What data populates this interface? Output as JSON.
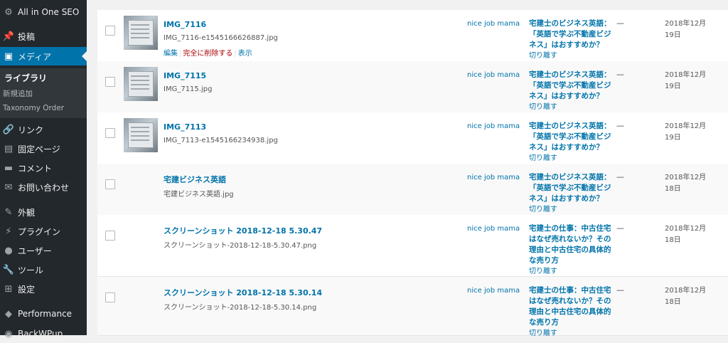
{
  "sidebar": {
    "items": [
      {
        "label": "All in One SEO",
        "icon": "seo-icon"
      },
      {
        "label": "投稿",
        "icon": "pin-icon"
      },
      {
        "label": "メディア",
        "icon": "media-icon",
        "active": true
      },
      {
        "label": "リンク",
        "icon": "link-icon"
      },
      {
        "label": "固定ページ",
        "icon": "page-icon"
      },
      {
        "label": "コメント",
        "icon": "comment-icon"
      },
      {
        "label": "お問い合わせ",
        "icon": "mail-icon"
      },
      {
        "label": "外観",
        "icon": "brush-icon"
      },
      {
        "label": "プラグイン",
        "icon": "plugin-icon"
      },
      {
        "label": "ユーザー",
        "icon": "user-icon"
      },
      {
        "label": "ツール",
        "icon": "wrench-icon"
      },
      {
        "label": "設定",
        "icon": "settings-icon"
      },
      {
        "label": "Performance",
        "icon": "performance-icon"
      },
      {
        "label": "BackWPup",
        "icon": "backup-icon"
      }
    ],
    "submenu": [
      "ライブラリ",
      "新規追加",
      "Taxonomy Order"
    ]
  },
  "actions": {
    "edit": "編集",
    "delete": "完全に削除する",
    "view": "表示"
  },
  "rows": [
    {
      "title": "IMG_7116",
      "file": "IMG_7116-e1545166626887.jpg",
      "author": "nice job mama",
      "attached": "宅建士のビジネス英語：「英語で学ぶ不動産ビジネス」はおすすめか？",
      "detach": "切り離す",
      "comments": "—",
      "date": "2018年12月19日"
    },
    {
      "title": "IMG_7115",
      "file": "IMG_7115.jpg",
      "author": "nice job mama",
      "attached": "宅建士のビジネス英語：「英語で学ぶ不動産ビジネス」はおすすめか？",
      "detach": "切り離す",
      "comments": "—",
      "date": "2018年12月19日"
    },
    {
      "title": "IMG_7113",
      "file": "IMG_7113-e1545166234938.jpg",
      "author": "nice job mama",
      "attached": "宅建士のビジネス英語：「英語で学ぶ不動産ビジネス」はおすすめか？",
      "detach": "切り離す",
      "comments": "—",
      "date": "2018年12月19日"
    },
    {
      "title": "宅建ビジネス英語",
      "file": "宅建ビジネス英語.jpg",
      "author": "nice job mama",
      "attached": "宅建士のビジネス英語：「英語で学ぶ不動産ビジネス」はおすすめか？",
      "detach": "切り離す",
      "comments": "—",
      "date": "2018年12月18日"
    },
    {
      "title": "スクリーンショット 2018-12-18 5.30.47",
      "file": "スクリーンショット-2018-12-18-5.30.47.png",
      "author": "nice job mama",
      "attached": "宅建士の仕事：中古住宅はなぜ売れないか？その理由と中古住宅の具体的な売り方",
      "detach": "切り離す",
      "comments": "—",
      "date": "2018年12月18日"
    },
    {
      "title": "スクリーンショット 2018-12-18 5.30.14",
      "file": "スクリーンショット-2018-12-18-5.30.14.png",
      "author": "nice job mama",
      "attached": "宅建士の仕事：中古住宅はなぜ売れないか？その理由と中古住宅の具体的な売り方",
      "detach": "切り離す",
      "comments": "—",
      "date": "2018年12月18日"
    }
  ]
}
